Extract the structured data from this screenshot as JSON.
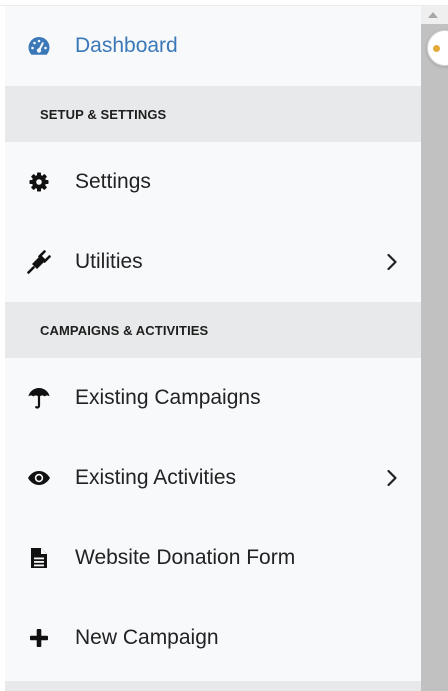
{
  "sidebar": {
    "dashboard": {
      "label": "Dashboard",
      "icon": "dashboard-gauge-icon"
    },
    "sections": {
      "setup": {
        "label": "SETUP & SETTINGS"
      },
      "campaigns": {
        "label": "CAMPAIGNS & ACTIVITIES"
      }
    },
    "items": {
      "settings": {
        "label": "Settings",
        "icon": "gear-icon"
      },
      "utilities": {
        "label": "Utilities",
        "icon": "plug-icon"
      },
      "existing_campaigns": {
        "label": "Existing Campaigns",
        "icon": "umbrella-icon"
      },
      "existing_activities": {
        "label": "Existing Activities",
        "icon": "eye-icon"
      },
      "website_donation_form": {
        "label": "Website Donation Form",
        "icon": "document-icon"
      },
      "new_campaign": {
        "label": "New Campaign",
        "icon": "plus-icon"
      }
    }
  },
  "colors": {
    "active_link": "#3a78b8",
    "section_bg": "#e8e9ea",
    "sidebar_bg": "#f8f9fb",
    "text": "#222222"
  }
}
